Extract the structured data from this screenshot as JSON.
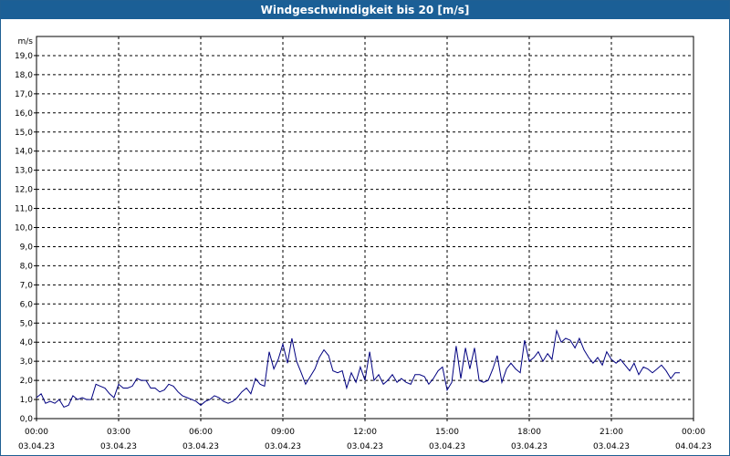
{
  "window": {
    "title": "Windgeschwindigkeit bis 20 [m/s]"
  },
  "chart_data": {
    "type": "line",
    "title": "Windgeschwindigkeit bis 20 [m/s]",
    "ylabel": "m/s",
    "xlabel": "",
    "ylim": [
      0,
      20
    ],
    "grid": true,
    "colors": {
      "line": "#000080",
      "grid": "#000000",
      "axis": "#000000"
    },
    "y_ticks": [
      "0,0",
      "1,0",
      "2,0",
      "3,0",
      "4,0",
      "5,0",
      "6,0",
      "7,0",
      "8,0",
      "9,0",
      "10,0",
      "11,0",
      "12,0",
      "13,0",
      "14,0",
      "15,0",
      "16,0",
      "17,0",
      "18,0",
      "19,0"
    ],
    "x_ticks": [
      {
        "time": "00:00",
        "date": "03.04.23"
      },
      {
        "time": "03:00",
        "date": "03.04.23"
      },
      {
        "time": "06:00",
        "date": "03.04.23"
      },
      {
        "time": "09:00",
        "date": "03.04.23"
      },
      {
        "time": "12:00",
        "date": "03.04.23"
      },
      {
        "time": "15:00",
        "date": "03.04.23"
      },
      {
        "time": "18:00",
        "date": "03.04.23"
      },
      {
        "time": "21:00",
        "date": "03.04.23"
      },
      {
        "time": "00:00",
        "date": "04.04.23"
      }
    ],
    "x_range_hours": [
      0,
      24
    ],
    "series": [
      {
        "x_hours": [
          0.0,
          0.17,
          0.33,
          0.5,
          0.67,
          0.83,
          1.0,
          1.17,
          1.33,
          1.5,
          1.67,
          1.83,
          2.0,
          2.17,
          2.33,
          2.5,
          2.67,
          2.83,
          3.0,
          3.17,
          3.33,
          3.5,
          3.67,
          3.83,
          4.0,
          4.17,
          4.33,
          4.5,
          4.67,
          4.83,
          5.0,
          5.17,
          5.33,
          5.5,
          5.67,
          5.83,
          6.0,
          6.17,
          6.33,
          6.5,
          6.67,
          6.83,
          7.0,
          7.17,
          7.33,
          7.5,
          7.67,
          7.83,
          8.0,
          8.17,
          8.33,
          8.5,
          8.67,
          8.83,
          9.0,
          9.17,
          9.33,
          9.5,
          9.67,
          9.83,
          10.0,
          10.17,
          10.33,
          10.5,
          10.67,
          10.83,
          11.0,
          11.17,
          11.33,
          11.5,
          11.67,
          11.83,
          12.0,
          12.17,
          12.33,
          12.5,
          12.67,
          12.83,
          13.0,
          13.17,
          13.33,
          13.5,
          13.67,
          13.83,
          14.0,
          14.17,
          14.33,
          14.5,
          14.67,
          14.83,
          15.0,
          15.17,
          15.33,
          15.5,
          15.67,
          15.83,
          16.0,
          16.17,
          16.33,
          16.5,
          16.67,
          16.83,
          17.0,
          17.17,
          17.33,
          17.5,
          17.67,
          17.83,
          18.0,
          18.17,
          18.33,
          18.5,
          18.67,
          18.83,
          19.0,
          19.17,
          19.33,
          19.5,
          19.67,
          19.83,
          20.0,
          20.17,
          20.33,
          20.5,
          20.67,
          20.83,
          21.0,
          21.17,
          21.33,
          21.5,
          21.67,
          21.83,
          22.0,
          22.17,
          22.33,
          22.5,
          22.67,
          22.83,
          23.0,
          23.17,
          23.33,
          23.5,
          23.67,
          23.83
        ],
        "values": [
          1.1,
          1.3,
          0.8,
          0.9,
          0.8,
          1.0,
          0.6,
          0.7,
          1.2,
          1.0,
          1.1,
          1.0,
          1.0,
          1.8,
          1.7,
          1.6,
          1.3,
          1.1,
          1.8,
          1.6,
          1.6,
          1.7,
          2.1,
          2.0,
          2.0,
          1.6,
          1.6,
          1.4,
          1.5,
          1.8,
          1.7,
          1.4,
          1.2,
          1.1,
          1.0,
          0.9,
          0.7,
          0.9,
          1.0,
          1.2,
          1.1,
          0.9,
          0.8,
          0.9,
          1.1,
          1.4,
          1.6,
          1.3,
          2.1,
          1.8,
          1.7,
          3.5,
          2.6,
          3.1,
          3.9,
          2.9,
          4.2,
          3.0,
          2.4,
          1.8,
          2.2,
          2.6,
          3.2,
          3.6,
          3.3,
          2.5,
          2.4,
          2.5,
          1.6,
          2.4,
          1.9,
          2.7,
          2.0,
          3.5,
          2.0,
          2.3,
          1.8,
          2.0,
          2.3,
          1.9,
          2.1,
          1.9,
          1.8,
          2.3,
          2.3,
          2.2,
          1.8,
          2.1,
          2.5,
          2.7,
          1.5,
          1.9,
          3.8,
          2.1,
          3.7,
          2.6,
          3.7,
          2.0,
          1.9,
          2.0,
          2.6,
          3.3,
          1.9,
          2.6,
          2.9,
          2.6,
          2.4,
          4.1,
          3.0,
          3.2,
          3.5,
          3.0,
          3.4,
          3.1,
          4.6,
          4.0,
          4.2,
          4.1,
          3.7,
          4.2,
          3.6,
          3.2,
          2.9,
          3.2,
          2.8,
          3.5,
          3.1,
          2.9,
          3.1,
          2.8,
          2.5,
          2.9,
          2.3,
          2.7,
          2.6,
          2.4,
          2.6,
          2.8,
          2.5,
          2.1,
          2.4,
          2.4
        ]
      }
    ]
  }
}
